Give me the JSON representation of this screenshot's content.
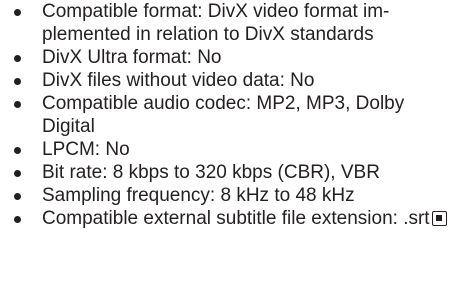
{
  "spec_list": {
    "items": [
      {
        "text": "Compatible format: DivX video format im-\nplemented in relation to DivX standards"
      },
      {
        "text": "DivX Ultra format: No"
      },
      {
        "text": "DivX files without video data: No"
      },
      {
        "text": "Compatible audio codec: MP2, MP3, Dolby Digital"
      },
      {
        "text": "LPCM: No"
      },
      {
        "text": "Bit rate: 8 kbps to 320 kbps (CBR), VBR"
      },
      {
        "text": "Sampling frequency: 8 kHz to 48 kHz"
      },
      {
        "text": "Compatible external subtitle file extension: .srt"
      }
    ],
    "end_mark_icon": "end-of-section-icon"
  }
}
